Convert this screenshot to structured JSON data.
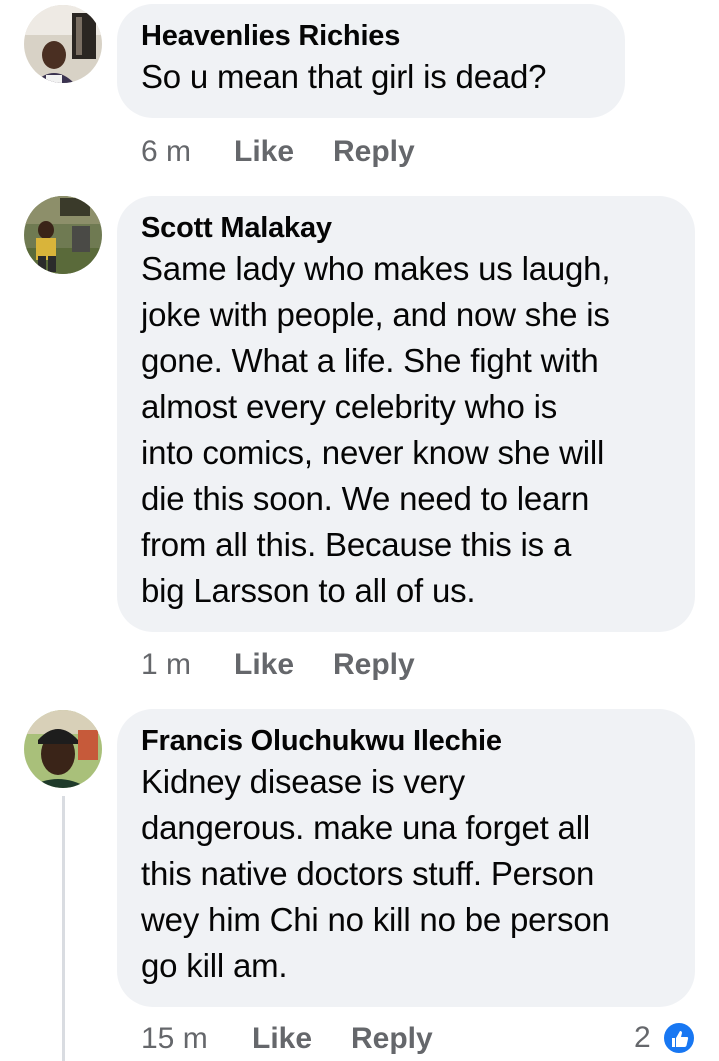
{
  "comments": [
    {
      "author": "Heavenlies Richies",
      "text": "So u mean that girl is dead?",
      "time": "6 m",
      "like_label": "Like",
      "reply_label": "Reply"
    },
    {
      "author": "Scott Malakay",
      "text": "Same lady who makes us laugh,\njoke with people, and now she is\ngone. What a life. She fight with\nalmost every celebrity who is\ninto comics, never know she will\ndie this soon. We need to learn\nfrom all this. Because this is a\nbig Larsson to all of us.",
      "time": "1 m",
      "like_label": "Like",
      "reply_label": "Reply"
    },
    {
      "author": "Francis Oluchukwu Ilechie",
      "text": "Kidney disease is very\ndangerous. make una forget all\nthis native doctors stuff. Person\nwey him Chi no kill no be person\ngo kill am.",
      "time": "15 m",
      "like_label": "Like",
      "reply_label": "Reply",
      "reaction_count": "2",
      "reaction_icon": "thumbs-up-icon"
    }
  ],
  "colors": {
    "bubble": "#f0f2f5",
    "meta": "#65676b",
    "reaction_blue": "#1877f2"
  }
}
